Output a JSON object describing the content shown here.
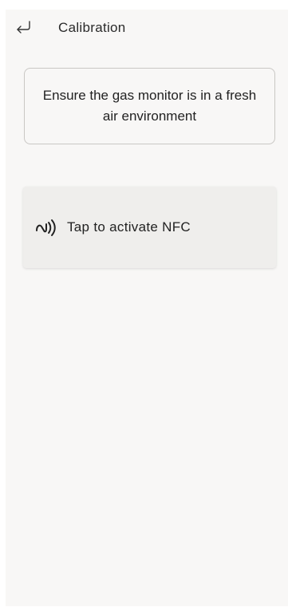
{
  "header": {
    "back_icon": "return-arrow-icon",
    "title": "Calibration"
  },
  "info_card": {
    "text": "Ensure the gas monitor is in a fresh air environment"
  },
  "nfc_card": {
    "icon": "nfc-icon",
    "label": "Tap to activate NFC"
  },
  "colors": {
    "background": "#f8f7f6",
    "card_background": "#efeeec",
    "border": "#c9c7c4",
    "text": "#222222"
  }
}
